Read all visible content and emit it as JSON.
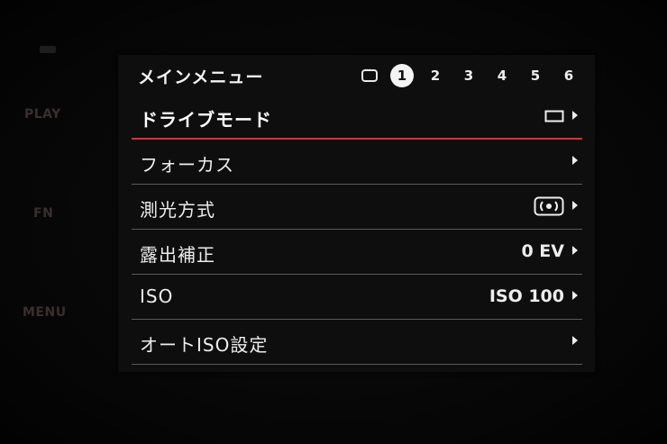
{
  "side_buttons": {
    "play": "PLAY",
    "fn": "FN",
    "menu": "MENU"
  },
  "header": {
    "title": "メインメニュー",
    "tabs": [
      "1",
      "2",
      "3",
      "4",
      "5",
      "6"
    ],
    "active_tab": "1",
    "chat_icon": "speech-bubble-icon"
  },
  "menu": {
    "items": [
      {
        "label": "ドライブモード",
        "value": "",
        "icon": "single-frame-icon",
        "selected": true
      },
      {
        "label": "フォーカス",
        "value": ""
      },
      {
        "label": "測光方式",
        "value": "",
        "icon": "center-weighted-metering-icon"
      },
      {
        "label": "露出補正",
        "value": "0 EV"
      },
      {
        "label": "ISO",
        "value": "ISO 100"
      },
      {
        "label": "オートISO設定",
        "value": ""
      }
    ]
  },
  "colors": {
    "selection_underline": "#d6323a",
    "screen_bg": "#0e0e0e",
    "text": "#ededed"
  }
}
